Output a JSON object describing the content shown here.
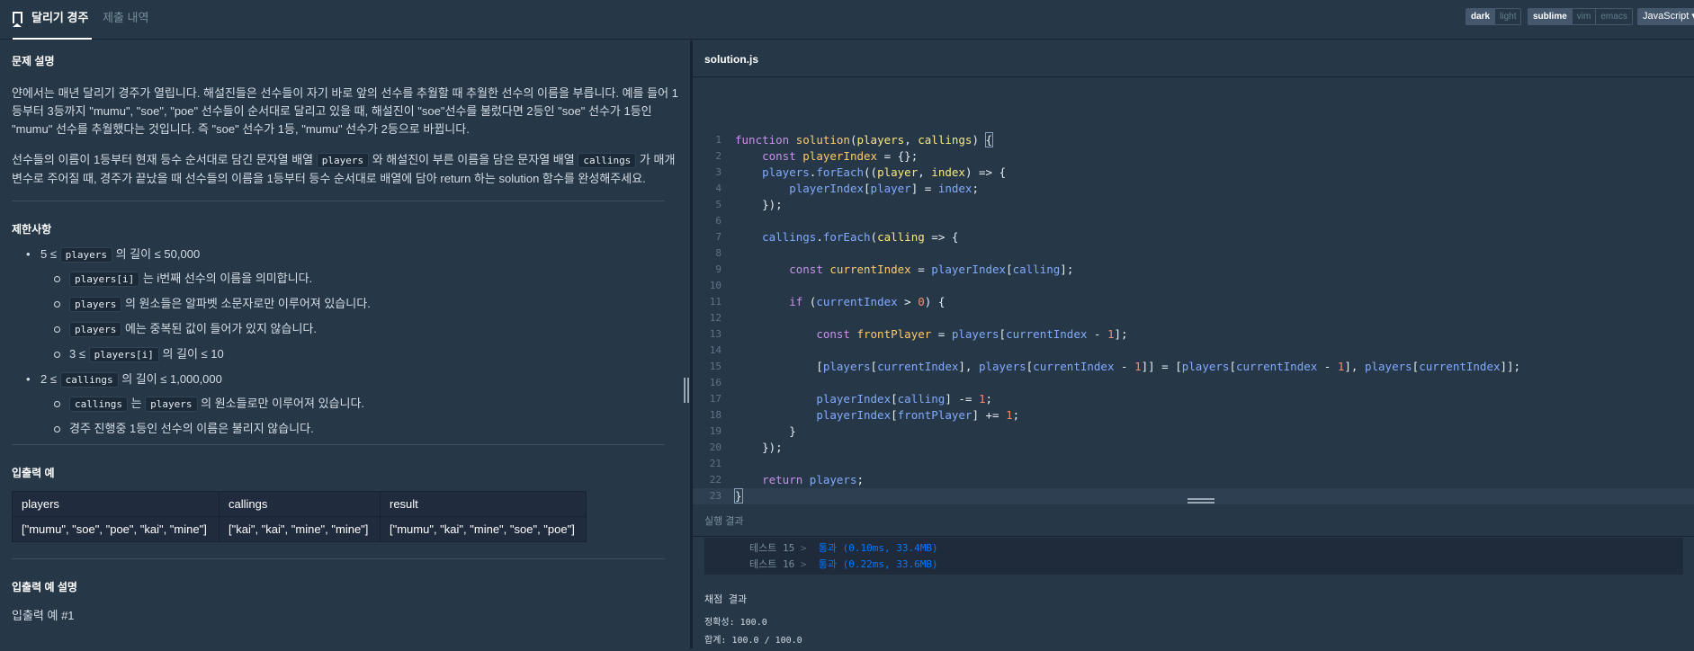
{
  "header": {
    "tabs": [
      {
        "label": "달리기 경주",
        "active": true
      },
      {
        "label": "제출 내역",
        "active": false
      }
    ],
    "theme_options": [
      "dark",
      "light"
    ],
    "theme_selected": "dark",
    "keymap_options": [
      "sublime",
      "vim",
      "emacs"
    ],
    "keymap_selected": "sublime",
    "language": "JavaScript"
  },
  "problem": {
    "description_title": "문제 설명",
    "p1": "얀에서는 매년 달리기 경주가 열립니다. 해설진들은 선수들이 자기 바로 앞의 선수를 추월할 때 추월한 선수의 이름을 부릅니다. 예를 들어 1등부터 3등까지 \"mumu\", \"soe\", \"poe\" 선수들이 순서대로 달리고 있을 때, 해설진이 \"soe\"선수를 불렀다면 2등인 \"soe\" 선수가 1등인 \"mumu\" 선수를 추월했다는 것입니다. 즉 \"soe\" 선수가 1등, \"mumu\" 선수가 2등으로 바뀝니다.",
    "p2_a": "선수들의 이름이 1등부터 현재 등수 순서대로 담긴 문자열 배열 ",
    "p2_code1": "players",
    "p2_b": " 와 해설진이 부른 이름을 담은 문자열 배열 ",
    "p2_code2": "callings",
    "p2_c": " 가 매개변수로 주어질 때, 경주가 끝났을 때 선수들의 이름을 1등부터 등수 순서대로 배열에 담아 return 하는 solution 함수를 완성해주세요.",
    "constraints_title": "제한사항",
    "c1_a": "5 ≤ ",
    "c1_code": "players",
    "c1_b": " 의 길이 ≤ 50,000",
    "c1_1_code": "players[i]",
    "c1_1_text": " 는 i번째 선수의 이름을 의미합니다.",
    "c1_2_code": "players",
    "c1_2_text": " 의 원소들은 알파벳 소문자로만 이루어져 있습니다.",
    "c1_3_code": "players",
    "c1_3_text": " 에는 중복된 값이 들어가 있지 않습니다.",
    "c1_4_a": "3 ≤ ",
    "c1_4_code": "players[i]",
    "c1_4_b": " 의 길이 ≤ 10",
    "c2_a": "2 ≤ ",
    "c2_code": "callings",
    "c2_b": " 의 길이 ≤ 1,000,000",
    "c2_1_code1": "callings",
    "c2_1_mid": " 는 ",
    "c2_1_code2": "players",
    "c2_1_text": " 의 원소들로만 이루어져 있습니다.",
    "c2_2_text": "경주 진행중 1등인 선수의 이름은 불리지 않습니다.",
    "io_title": "입출력 예",
    "table": {
      "headers": [
        "players",
        "callings",
        "result"
      ],
      "rows": [
        [
          "[\"mumu\", \"soe\", \"poe\", \"kai\", \"mine\"]",
          "[\"kai\", \"kai\", \"mine\", \"mine\"]",
          "[\"mumu\", \"kai\", \"mine\", \"soe\", \"poe\"]"
        ]
      ]
    },
    "io_explain_title": "입출력 예 설명",
    "io_example_1": "입출력 예 #1"
  },
  "editor": {
    "filename": "solution.js",
    "line_numbers": [
      "1",
      "2",
      "3",
      "4",
      "5",
      "6",
      "7",
      "8",
      "9",
      "10",
      "11",
      "12",
      "13",
      "14",
      "15",
      "16",
      "17",
      "18",
      "19",
      "20",
      "21",
      "22",
      "23"
    ]
  },
  "results": {
    "title": "실행 결과",
    "tests": [
      {
        "name": "테스트 15",
        "status": "통과 (0.10ms, 33.4MB)"
      },
      {
        "name": "테스트 16",
        "status": "통과 (0.22ms, 33.6MB)"
      }
    ],
    "grade_title": "채점 결과",
    "accuracy": "정확성: 100.0",
    "total": "합계: 100.0 / 100.0"
  }
}
